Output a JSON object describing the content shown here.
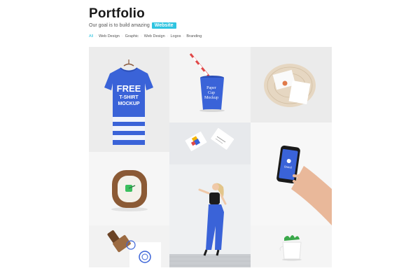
{
  "header": {
    "title": "Portfolio",
    "subtitle_text": "Our goal is to build amazing",
    "badge": "Website"
  },
  "filters": [
    "All",
    "Web Design",
    "Graphic",
    "Web Design",
    "Logos",
    "Branding"
  ],
  "active_filter": "All",
  "colors": {
    "accent": "#2ec4e0",
    "brand_blue": "#3a63d8"
  },
  "gallery": {
    "tshirt": {
      "line1": "FREE",
      "line2": "T-SHIRT",
      "line3": "MOCKUP"
    },
    "cup": {
      "line1": "Paper",
      "line2": "Cup",
      "line3": "Mockup"
    },
    "phone": {
      "label": "Brand"
    }
  }
}
